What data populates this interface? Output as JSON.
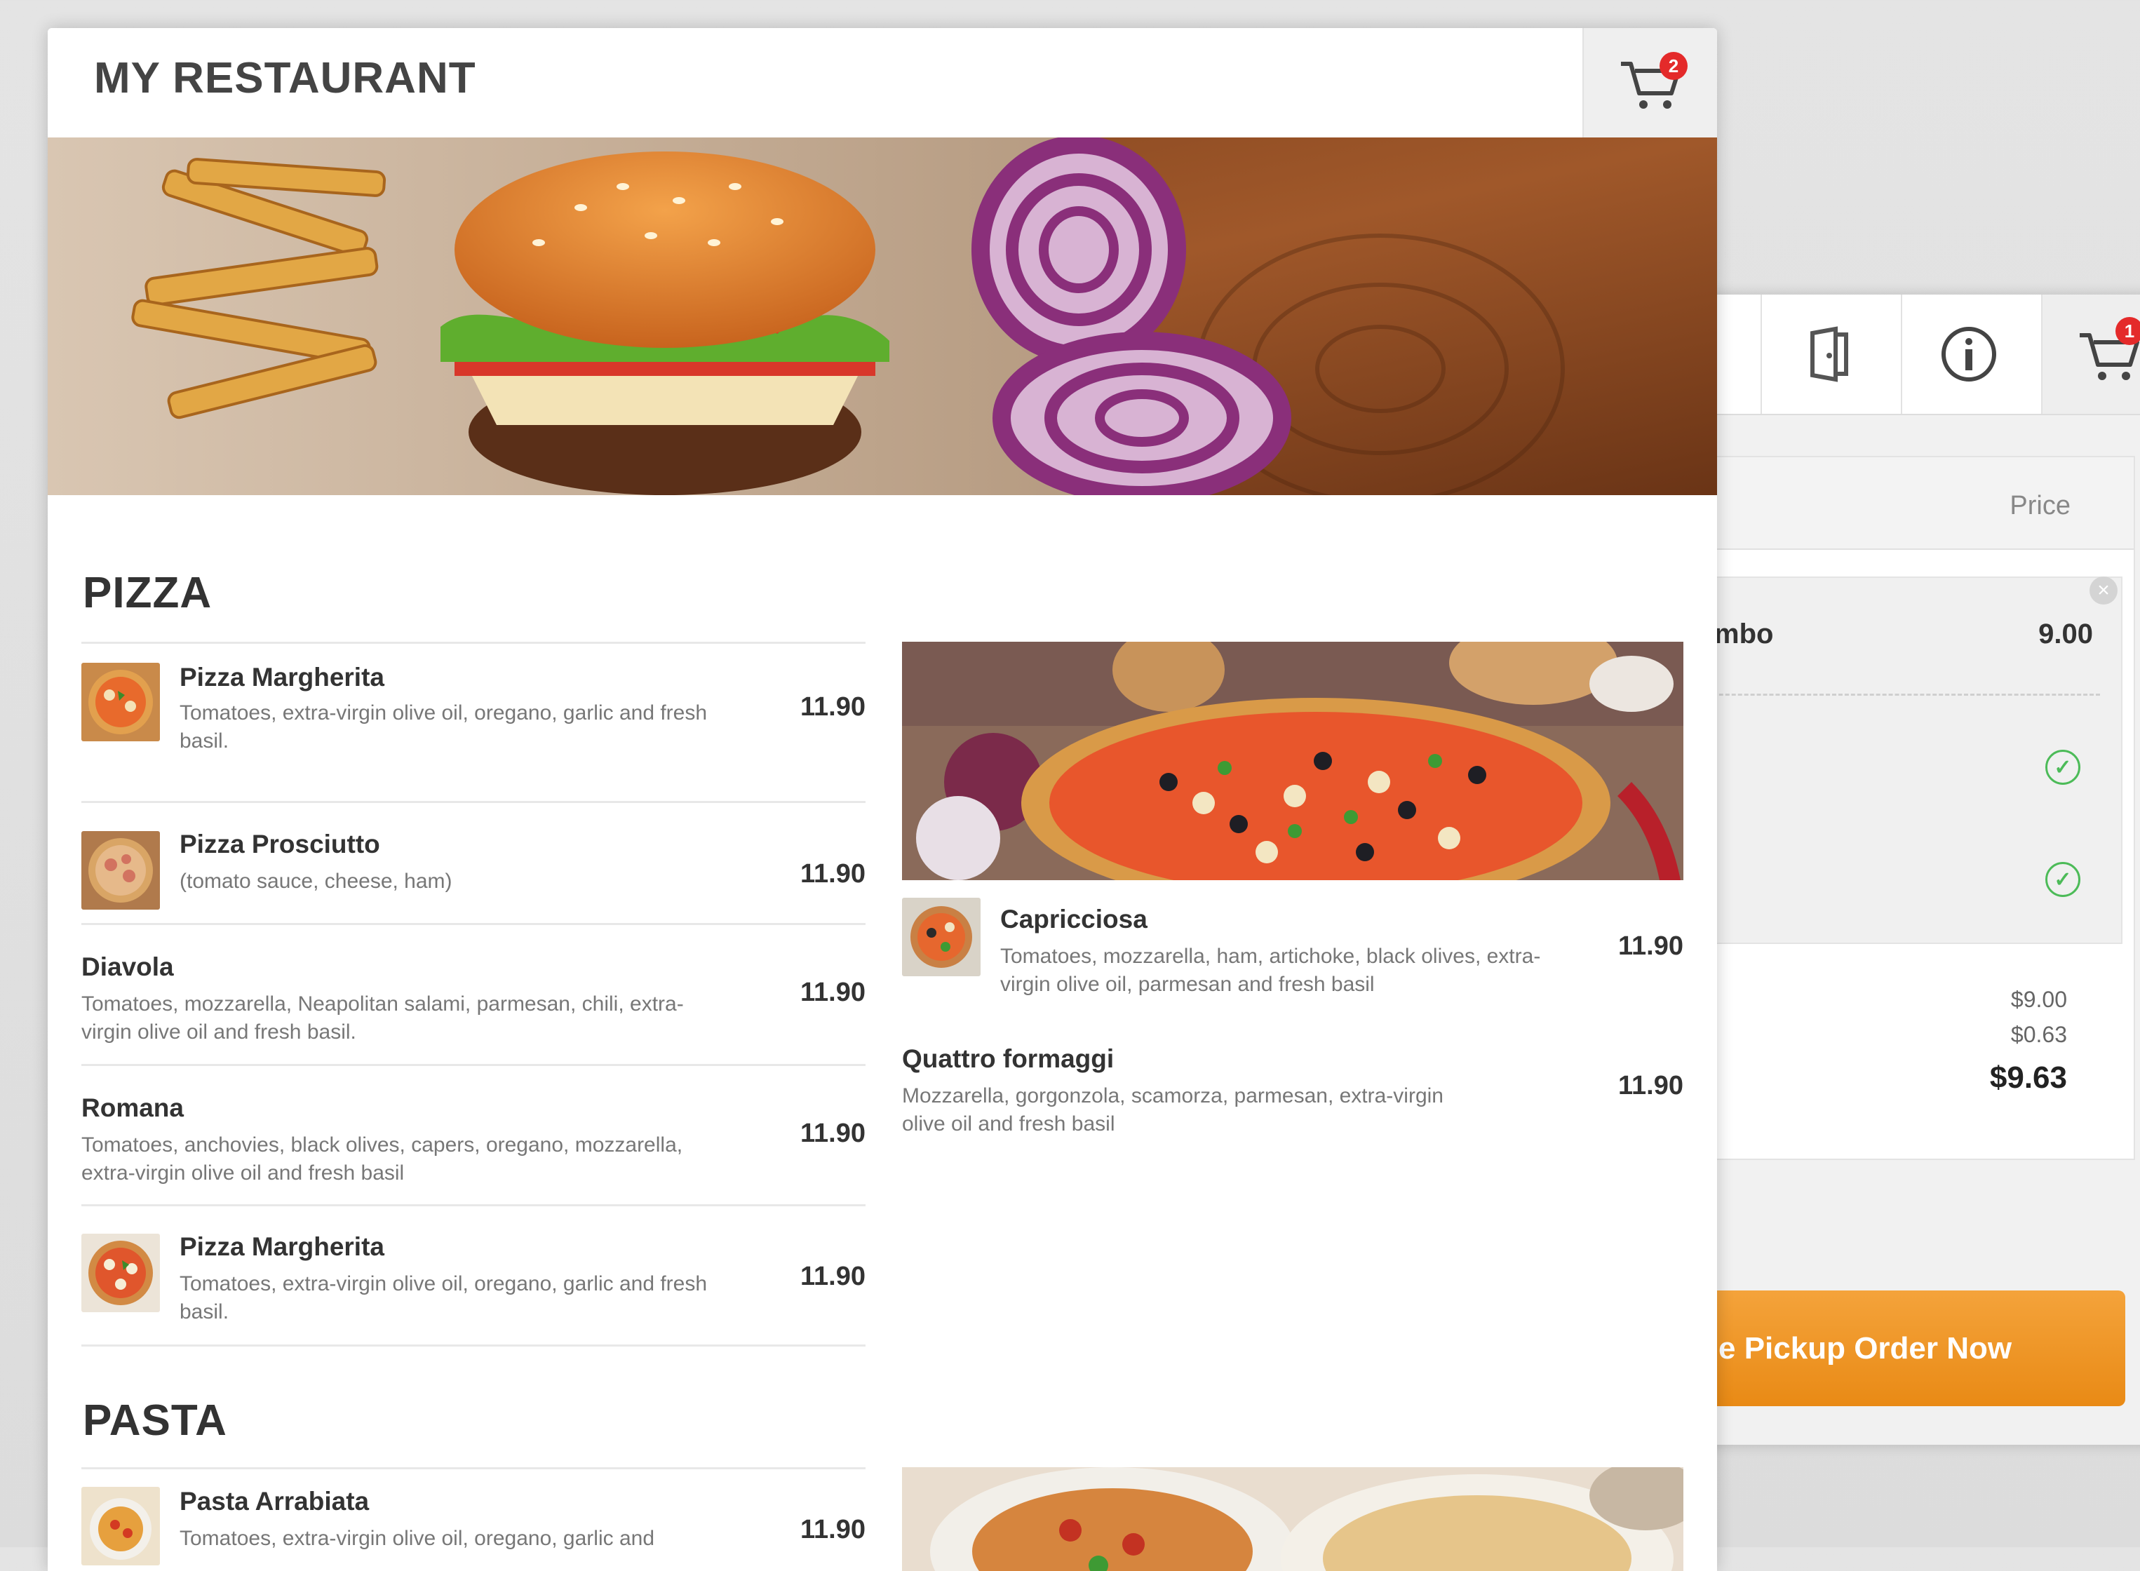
{
  "app": {
    "title": "MY RESTAURANT",
    "cart_count": "2"
  },
  "back_window": {
    "cart_count": "1",
    "price_label": "Price",
    "item_name": "mbo",
    "item_price": "9.00",
    "subtotal": "$9.00",
    "tax": "$0.63",
    "total": "$9.63",
    "order_button": "e Pickup Order Now"
  },
  "sections": [
    {
      "title": "PIZZA",
      "left_items": [
        {
          "name": "Pizza Margherita",
          "desc": "Tomatoes, extra-virgin olive oil, oregano, garlic and fresh basil.",
          "price": "11.90",
          "thumb": "margherita"
        },
        {
          "name": "Pizza Prosciutto",
          "desc": "(tomato sauce, cheese, ham)",
          "price": "11.90",
          "thumb": "prosciutto"
        },
        {
          "name": "Diavola",
          "desc": "Tomatoes, mozzarella, Neapolitan salami, parmesan, chili, extra-virgin olive oil and fresh basil.",
          "price": "11.90"
        },
        {
          "name": "Romana",
          "desc": "Tomatoes, anchovies, black olives, capers, oregano, mozzarella, extra-virgin olive oil and fresh basil",
          "price": "11.90"
        },
        {
          "name": "Pizza Margherita",
          "desc": "Tomatoes, extra-virgin olive oil, oregano, garlic and fresh basil.",
          "price": "11.90",
          "thumb": "margherita2"
        }
      ],
      "right_items": [
        {
          "name": "Capricciosa",
          "desc": "Tomatoes, mozzarella, ham, artichoke, black olives, extra-virgin olive oil, parmesan and fresh basil",
          "price": "11.90",
          "thumb": "capricciosa"
        },
        {
          "name": "Quattro formaggi",
          "desc": "Mozzarella, gorgonzola, scamorza, parmesan, extra-virgin olive oil and fresh basil",
          "price": "11.90"
        }
      ]
    },
    {
      "title": "PASTA",
      "left_items": [
        {
          "name": "Pasta Arrabiata",
          "desc": "Tomatoes, extra-virgin olive oil, oregano, garlic and",
          "price": "11.90",
          "thumb": "pasta"
        }
      ]
    }
  ],
  "icons": {
    "cart": "cart-icon",
    "door": "door-icon",
    "info": "info-icon",
    "check": "check-icon",
    "close": "close-icon"
  },
  "colors": {
    "accent": "#e98a15",
    "badge": "#e42a2a",
    "check": "#4cbb58"
  }
}
